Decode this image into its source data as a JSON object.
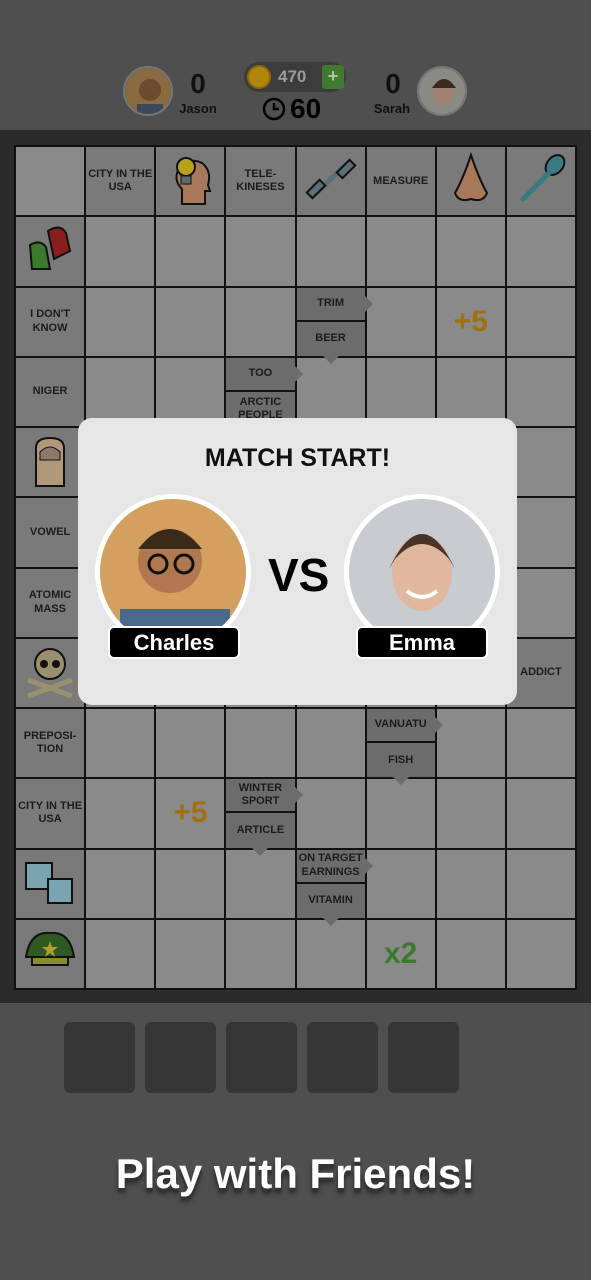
{
  "header": {
    "left_player": {
      "name": "Jason",
      "score": "0"
    },
    "right_player": {
      "name": "Sarah",
      "score": "0"
    },
    "coins": "470",
    "add_coins": "+",
    "timer": "60"
  },
  "board": {
    "rows": 12,
    "cols": 8,
    "cells": [
      {
        "r": 0,
        "c": 1,
        "text": "CITY IN THE USA"
      },
      {
        "r": 0,
        "c": 2,
        "icon": "lightbulb-head-icon"
      },
      {
        "r": 0,
        "c": 3,
        "text": "TELE-KINESES"
      },
      {
        "r": 0,
        "c": 4,
        "icon": "dumbbell-icon"
      },
      {
        "r": 0,
        "c": 5,
        "text": "MEASURE"
      },
      {
        "r": 0,
        "c": 6,
        "icon": "nose-icon"
      },
      {
        "r": 0,
        "c": 7,
        "icon": "spoon-icon"
      },
      {
        "r": 1,
        "c": 0,
        "icon": "mittens-icon"
      },
      {
        "r": 2,
        "c": 0,
        "text": "I DON'T KNOW"
      },
      {
        "r": 2,
        "c": 4,
        "top": "TRIM",
        "bottom": "BEER"
      },
      {
        "r": 2,
        "c": 6,
        "bonus": "+5",
        "color": "#a0700f"
      },
      {
        "r": 3,
        "c": 0,
        "text": "NIGER"
      },
      {
        "r": 3,
        "c": 3,
        "top": "TOO",
        "bottom": "ARCTIC PEOPLE"
      },
      {
        "r": 4,
        "c": 0,
        "icon": "fingernail-icon"
      },
      {
        "r": 5,
        "c": 0,
        "text": "VOWEL"
      },
      {
        "r": 6,
        "c": 0,
        "text": "ATOMIC MASS"
      },
      {
        "r": 7,
        "c": 0,
        "icon": "skull-icon"
      },
      {
        "r": 7,
        "c": 7,
        "text": "ADDICT"
      },
      {
        "r": 8,
        "c": 0,
        "text": "PREPOSI-TION"
      },
      {
        "r": 8,
        "c": 5,
        "top": "VANUATU",
        "bottom": "FISH"
      },
      {
        "r": 9,
        "c": 0,
        "text": "CITY IN THE USA"
      },
      {
        "r": 9,
        "c": 2,
        "bonus": "+5",
        "color": "#a0700f"
      },
      {
        "r": 9,
        "c": 3,
        "top": "WINTER SPORT",
        "bottom": "ARTICLE"
      },
      {
        "r": 10,
        "c": 0,
        "icon": "ice-cubes-icon"
      },
      {
        "r": 10,
        "c": 4,
        "top": "ON TARGET EARNINGS",
        "bottom": "VITAMIN"
      },
      {
        "r": 11,
        "c": 0,
        "icon": "military-hat-icon"
      },
      {
        "r": 11,
        "c": 5,
        "bonus": "x2",
        "color": "#3a7a2a"
      }
    ]
  },
  "modal": {
    "title": "MATCH START!",
    "vs": "VS",
    "player1": "Charles",
    "player2": "Emma"
  },
  "promo": "Play with Friends!"
}
